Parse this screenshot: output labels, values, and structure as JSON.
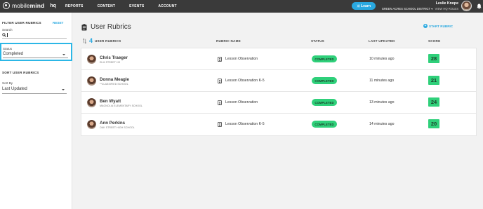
{
  "topbar": {
    "logo_text_light": "mobile",
    "logo_text_bold": "mind",
    "logo_suffix": "hq",
    "nav": [
      "REPORTS",
      "CONTENT",
      "EVENTS",
      "ACCOUNT"
    ],
    "learn_label": "Learn",
    "user_name": "Leslie Knope",
    "district": "GREEN ACRES SCHOOL DISTRICT",
    "view_roles": "VIEW HQ ROLES"
  },
  "sidebar": {
    "filter_title": "FILTER USER RUBRICS",
    "reset_label": "RESET",
    "search_label": "Search",
    "search_value": "",
    "status_label": "Status",
    "status_value": "Completed",
    "sort_title": "SORT USER RUBRICS",
    "sort_label": "Sort By",
    "sort_value": "Last Updated"
  },
  "main": {
    "title": "User Rubrics",
    "start_rubric": "START RUBRIC",
    "count": "4",
    "count_label": "USER RUBRICS",
    "columns": {
      "rubric_name": "RUBRIC NAME",
      "status": "STATUS",
      "last_updated": "LAST UPDATED",
      "score": "SCORE"
    },
    "rows": [
      {
        "name": "Chris Traeger",
        "school": "ELM STREET HS",
        "rubric": "Lesson Observation",
        "status": "COMPLETED",
        "updated": "10 minutes ago",
        "score": "28"
      },
      {
        "name": "Donna Meagle",
        "school": "**CLASSIFIED SCHOOL",
        "rubric": "Lesson Observation K-5",
        "status": "COMPLETED",
        "updated": "11 minutes ago",
        "score": "21"
      },
      {
        "name": "Ben Wyatt",
        "school": "MAGNOLIA ELEMENTARY SCHOOL",
        "rubric": "Lesson Observation",
        "status": "COMPLETED",
        "updated": "13 minutes ago",
        "score": "24"
      },
      {
        "name": "Ann Perkins",
        "school": "OAK STREET HIGH SCHOOL",
        "rubric": "Lesson Observation K-5",
        "status": "COMPLETED",
        "updated": "14 minutes ago",
        "score": "20"
      }
    ]
  },
  "colors": {
    "accent": "#29a8e0",
    "success": "#2fd07a",
    "topbar": "#3a3a3a"
  }
}
